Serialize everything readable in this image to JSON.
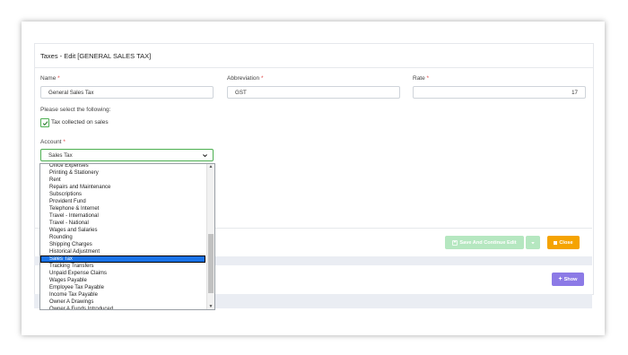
{
  "page": {
    "title": "Taxes - Edit [GENERAL SALES TAX]"
  },
  "form": {
    "name_label": "Name",
    "name_value": "General Sales Tax",
    "abbr_label": "Abbreviation",
    "abbr_value": "GST",
    "rate_label": "Rate",
    "rate_value": "17",
    "required_marker": "*",
    "select_following": "Please select the following:",
    "tax_collected_label": "Tax collected on sales",
    "tax_collected_checked": true,
    "account_label": "Account",
    "account_value": "Sales Tax"
  },
  "dropdown": {
    "items": [
      "Office Expenses",
      "Printing & Stationery",
      "Rent",
      "Repairs and Maintenance",
      "Subscriptions",
      "Provident Fund",
      "Telephone & Internet",
      "Travel - International",
      "Travel - National",
      "Wages and Salaries",
      "Rounding",
      "Shipping Charges",
      "Historical Adjustment",
      "Sales Tax",
      "Tracking Transfers",
      "Unpaid Expense Claims",
      "Wages Payable",
      "Employee Tax Payable",
      "Income Tax Payable",
      "Owner A Drawings",
      "Owner A Funds Introduced"
    ],
    "selected": "Sales Tax"
  },
  "actions": {
    "save_continue": "Save And Continue Edit",
    "close": "Close",
    "show": "Show"
  },
  "colors": {
    "green_border": "#4caf50",
    "save_green": "#b5e7c0",
    "close_orange": "#f5a300",
    "show_purple": "#8c7ae6",
    "selected_blue": "#1a73e8"
  }
}
